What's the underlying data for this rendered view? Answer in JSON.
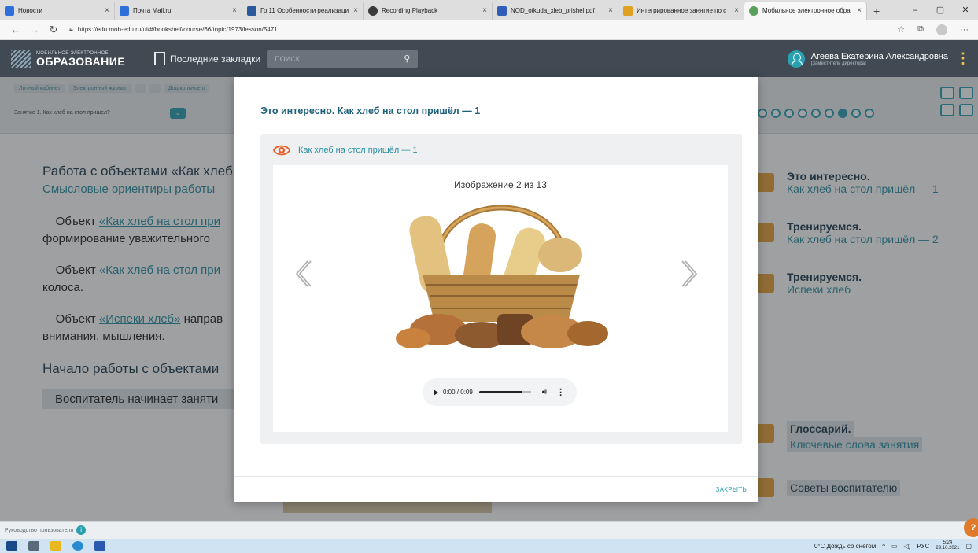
{
  "browser": {
    "tabs": [
      {
        "label": "Новости",
        "color": "#2f6fdc",
        "active": false
      },
      {
        "label": "Почта Mail.ru",
        "color": "#2f6fdc",
        "active": false
      },
      {
        "label": "Гр.11 Особенности реализаци",
        "color": "#2a5a9c",
        "active": false
      },
      {
        "label": "Recording Playback",
        "color": "#3a3a3a",
        "active": false
      },
      {
        "label": "NOD_otkuda_xleb_prishel.pdf",
        "color": "#2f5db8",
        "active": false
      },
      {
        "label": "Интегрированное занятие по с",
        "color": "#e0a020",
        "active": false
      },
      {
        "label": "Мобильное электронное обра",
        "color": "#5aa05a",
        "active": true
      }
    ],
    "new_tab": "+",
    "url": "https://edu.mob-edu.ru/ui/#/bookshelf/course/66/topic/1973/lesson/5471"
  },
  "header": {
    "logo_small": "МОБИЛЬНОЕ ЭЛЕКТРОННОЕ",
    "logo_big": "ОБРАЗОВАНИЕ",
    "bookmarks_label": "Последние закладки",
    "search_placeholder": "ПОИСК",
    "user_name": "Агеева Екатерина Александровна",
    "user_role": "[Заместитель директора]"
  },
  "subnav": {
    "breadcrumbs": [
      "Личный кабинет",
      "Электронный журнал",
      "",
      "",
      "Дошкольное о"
    ],
    "lesson_select": "Занятие 1. Как хлеб на стол пришел?"
  },
  "page": {
    "heading": "Работа с объектами «Как хлеб",
    "subheading": "Смысловые ориентиры работы",
    "p1_prefix": "Объект ",
    "p1_link": "«Как хлеб на стол при",
    "p1_rest": "формирование уважительного",
    "p2_prefix": "Объект ",
    "p2_link": "«Как хлеб на стол при",
    "p2_rest": "колоса.",
    "p3_prefix": "Объект ",
    "p3_link": "«Испеки хлеб»",
    "p3_mid": " направ",
    "p3_rest": "внимания, мышления.",
    "start_heading": "Начало работы с объектами",
    "teacher_start": "Воспитатель начинает заняти"
  },
  "right_panel": {
    "items": [
      {
        "title": "Это интересно.",
        "subtitle": "Как хлеб на стол пришёл — 1"
      },
      {
        "title": "Тренируемся.",
        "subtitle": "Как хлеб на стол пришёл — 2"
      },
      {
        "title": "Тренируемся.",
        "subtitle": "Испеки хлеб"
      }
    ],
    "glossary_title": "Глоссарий.",
    "glossary_sub": "Ключевые слова занятия",
    "tips": "Советы воспитателю"
  },
  "footer": {
    "guide": "Руководство пользователя",
    "help_button": "?"
  },
  "modal": {
    "title": "Это интересно. Как хлеб на стол пришёл — 1",
    "inner_title": "Как хлеб на стол пришёл — 1",
    "counter": "Изображение 2 из 13",
    "image_index": 2,
    "image_total": 13,
    "audio_time": "0:00 / 0:09",
    "audio_progress": 0.0,
    "close_label": "ЗАКРЫТЬ"
  },
  "taskbar": {
    "weather": "0°C  Дождь со снегом",
    "lang": "РУС",
    "time": "5:24",
    "date": "29.10.2021"
  },
  "colors": {
    "accent": "#2a9fb0",
    "header_bg": "#414a52",
    "modal_title": "#1e5f79",
    "orange": "#e8a23a"
  }
}
